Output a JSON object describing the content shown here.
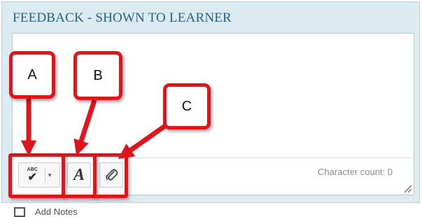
{
  "section": {
    "title": "FEEDBACK - SHOWN TO LEARNER"
  },
  "editor": {
    "text": "",
    "char_count_label": "Character count: 0"
  },
  "toolbar": {
    "spellcheck_icon": "spellcheck-icon",
    "spellcheck_abc": "ABC",
    "spellcheck_check": "✔",
    "dropdown_glyph": "▾",
    "font_icon": "font-format-icon",
    "font_glyph": "A",
    "attach_icon": "paperclip-icon"
  },
  "notes": {
    "label": "Add Notes",
    "icon": "notes-icon"
  },
  "annotations": {
    "a": "A",
    "b": "B",
    "c": "C",
    "color": "#e0141a"
  },
  "colors": {
    "panel": "#dceaf2",
    "title": "#2b5f86",
    "highlight": "#e0141a"
  }
}
